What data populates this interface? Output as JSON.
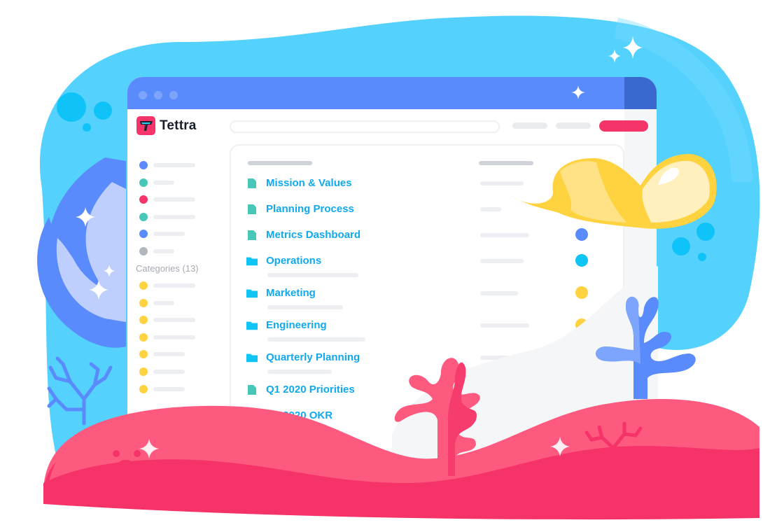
{
  "app": {
    "name": "Tettra",
    "logo_icon": "tettra-logo-icon"
  },
  "window": {
    "controls": [
      "close-dot",
      "minimize-dot",
      "maximize-dot"
    ]
  },
  "topbar": {
    "search_placeholder": "",
    "nav_pills": [
      "nav-link-1",
      "nav-link-2"
    ],
    "cta_color": "#f5356a"
  },
  "sidebar": {
    "items": [
      {
        "color": "#5a8bfc",
        "bar": 0.6
      },
      {
        "color": "#46c7b8",
        "bar": 0.3
      },
      {
        "color": "#f5356a",
        "bar": 0.6
      },
      {
        "color": "#46c7b8",
        "bar": 0.6
      },
      {
        "color": "#5a8bfc",
        "bar": 0.45
      },
      {
        "color": "#b2b7bd",
        "bar": 0.3
      }
    ],
    "categories_label": "Categories (13)",
    "categories": [
      {
        "color": "#ffd23f",
        "bar": 0.6
      },
      {
        "color": "#ffd23f",
        "bar": 0.3
      },
      {
        "color": "#ffd23f",
        "bar": 0.6
      },
      {
        "color": "#ffd23f",
        "bar": 0.6
      },
      {
        "color": "#ffd23f",
        "bar": 0.45
      },
      {
        "color": "#ffd23f",
        "bar": 0.45
      },
      {
        "color": "#ffd23f",
        "bar": 0.45
      }
    ]
  },
  "main": {
    "rows": [
      {
        "type": "document",
        "title": "Mission & Values",
        "status_color": null
      },
      {
        "type": "document",
        "title": "Planning Process",
        "status_color": null
      },
      {
        "type": "document",
        "title": "Metrics Dashboard",
        "status_color": "#5a8bfc"
      },
      {
        "type": "folder",
        "title": "Operations",
        "status_color": "#10c4f4"
      },
      {
        "type": "folder",
        "title": "Marketing",
        "status_color": "#ffd23f"
      },
      {
        "type": "folder",
        "title": "Engineering",
        "status_color": "#ffd23f"
      },
      {
        "type": "folder",
        "title": "Quarterly Planning",
        "status_color": "#5a8bfc"
      },
      {
        "type": "document",
        "title": "Q1 2020 Priorities",
        "status_color": "#10c4f4"
      },
      {
        "type": "document",
        "title": "Q1 2020 OKR",
        "status_color": null
      }
    ]
  },
  "colors": {
    "accent_blue": "#5a8bfc",
    "link_blue": "#10a9ee",
    "brand_pink": "#f5356a",
    "doc_teal": "#46c7b8",
    "folder_blue": "#10c4f4",
    "sky_blue": "#55d1fd",
    "yellow": "#ffd23f"
  }
}
